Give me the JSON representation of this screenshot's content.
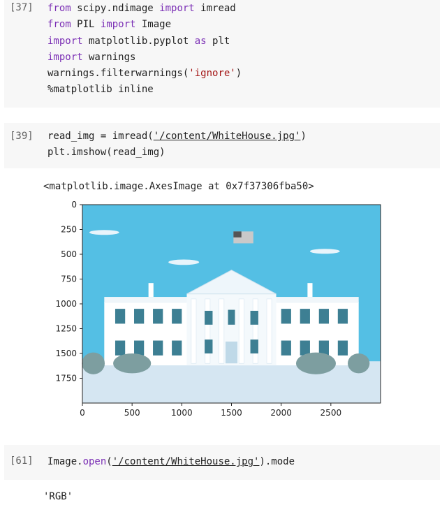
{
  "cells": [
    {
      "prompt": "[37]",
      "lines": [
        [
          {
            "t": "from",
            "k": "kw"
          },
          {
            "t": " scipy.ndimage ",
            "k": ""
          },
          {
            "t": "import",
            "k": "kw"
          },
          {
            "t": " imread",
            "k": ""
          }
        ],
        [
          {
            "t": "from",
            "k": "kw"
          },
          {
            "t": " PIL ",
            "k": ""
          },
          {
            "t": "import",
            "k": "kw"
          },
          {
            "t": " Image",
            "k": ""
          }
        ],
        [
          {
            "t": "import",
            "k": "kw"
          },
          {
            "t": " matplotlib.pyplot ",
            "k": ""
          },
          {
            "t": "as",
            "k": "kw"
          },
          {
            "t": " plt",
            "k": ""
          }
        ],
        [
          {
            "t": "import",
            "k": "kw"
          },
          {
            "t": " warnings",
            "k": ""
          }
        ],
        [
          {
            "t": "warnings.filterwarnings(",
            "k": ""
          },
          {
            "t": "'ignore'",
            "k": "str"
          },
          {
            "t": ")",
            "k": ""
          }
        ],
        [
          {
            "t": "%matplotlib inline",
            "k": ""
          }
        ]
      ]
    },
    {
      "prompt": "[39]",
      "lines": [
        [
          {
            "t": "read_img = imread(",
            "k": ""
          },
          {
            "t": "'/content/WhiteHouse.jpg'",
            "k": "strline"
          },
          {
            "t": ")",
            "k": ""
          }
        ],
        [
          {
            "t": "plt.imshow(read_img)",
            "k": ""
          }
        ]
      ]
    },
    {
      "prompt": "[61]",
      "lines": [
        [
          {
            "t": "Image.",
            "k": ""
          },
          {
            "t": "open",
            "k": "kw"
          },
          {
            "t": "(",
            "k": ""
          },
          {
            "t": "'/content/WhiteHouse.jpg'",
            "k": "strline"
          },
          {
            "t": ").mode",
            "k": ""
          }
        ]
      ]
    }
  ],
  "output_39": "<matplotlib.image.AxesImage at 0x7f37306fba50>",
  "output_61": "'RGB'",
  "chart_data": {
    "type": "image",
    "xlim": [
      0,
      3000
    ],
    "ylim": [
      2000,
      0
    ],
    "xticks": [
      0,
      500,
      1000,
      1500,
      2000,
      2500
    ],
    "yticks": [
      0,
      250,
      500,
      750,
      1000,
      1250,
      1500,
      1750
    ],
    "colors": {
      "sky": "#54bfe4",
      "ground": "#d5e6f2",
      "bush": "#7d9ea0",
      "house": "#ffffff",
      "window": "#3d7f93"
    }
  }
}
